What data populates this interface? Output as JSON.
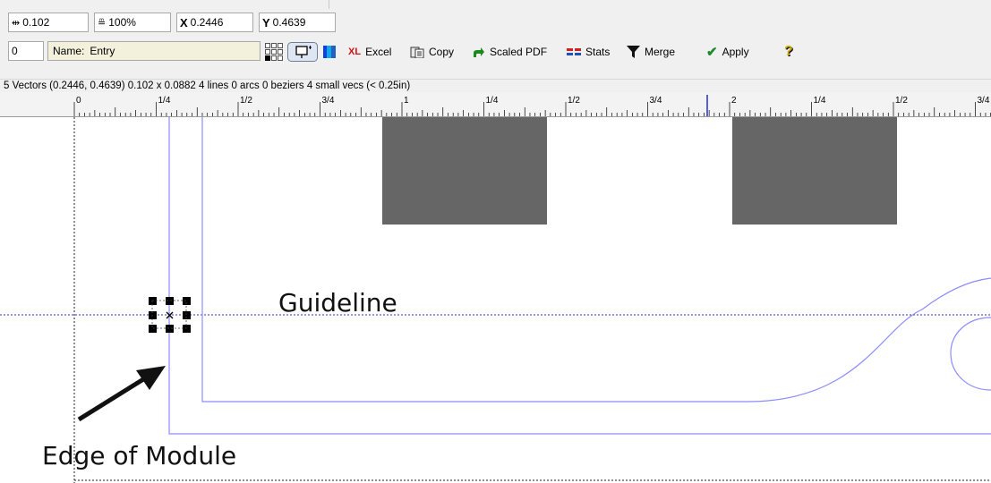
{
  "toolbar": {
    "width_value": "0.102",
    "scale_value": "100%",
    "x_label": "X",
    "x_value": "0.2446",
    "y_label": "Y",
    "y_value": "0.4639",
    "index_value": "0",
    "name_label": "Name:",
    "name_value": "Entry",
    "tools": {
      "excel": "Excel",
      "excel_icon_text": "XL",
      "copy": "Copy",
      "scaled_pdf": "Scaled PDF",
      "stats": "Stats",
      "merge": "Merge",
      "apply": "Apply"
    }
  },
  "status": {
    "text": "5 Vectors  (0.2446, 0.4639)  0.102 x 0.0882   4 lines   0 arcs   0 beziers   4 small vecs (< 0.25in)"
  },
  "ruler": {
    "labels": [
      "0",
      "1/4",
      "1/2",
      "3/4",
      "1",
      "1/4",
      "1/2",
      "3/4",
      "2",
      "1/4",
      "1/2",
      "3/4"
    ]
  },
  "canvas": {
    "guideline_label": "Guideline",
    "edge_label": "Edge of Module"
  },
  "colors": {
    "vector_line": "#8c8cff",
    "block_fill": "#666666",
    "toolbar_bg": "#f0f0f0",
    "name_field_bg": "#f3f1dc"
  }
}
